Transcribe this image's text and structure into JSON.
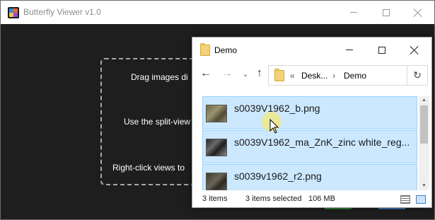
{
  "app": {
    "title": "Butterfly Viewer v1.0",
    "hints": [
      "Drag images di",
      "Use the split-view",
      "Right-click views to"
    ]
  },
  "explorer": {
    "title": "Demo",
    "address": {
      "overflow": "«",
      "segments": [
        "Desk...",
        "Demo"
      ],
      "separator": "›"
    },
    "nav": {
      "back": "←",
      "forward": "→",
      "recent": "⌄",
      "up": "↑",
      "refresh": "↻"
    },
    "files": [
      {
        "name": "s0039V1962_b.png",
        "selected": true
      },
      {
        "name": "s0039V1962_ma_ZnK_zinc white_reg...",
        "selected": true
      },
      {
        "name": "s0039v1962_r2.png",
        "selected": true
      }
    ],
    "status": {
      "items": "3 items",
      "selected": "3 items selected",
      "size": "106 MB"
    }
  },
  "icons": {
    "app": "butterfly-viewer-app-icon",
    "folder": "folder-icon",
    "cursor": "mouse-cursor-icon"
  },
  "colors": {
    "app_background": "#1e1e1e",
    "selection_fill": "#cce8ff",
    "selection_border": "#99d1ff",
    "folder": "#f3d27a",
    "cursor_highlight": "#f6e86e"
  }
}
